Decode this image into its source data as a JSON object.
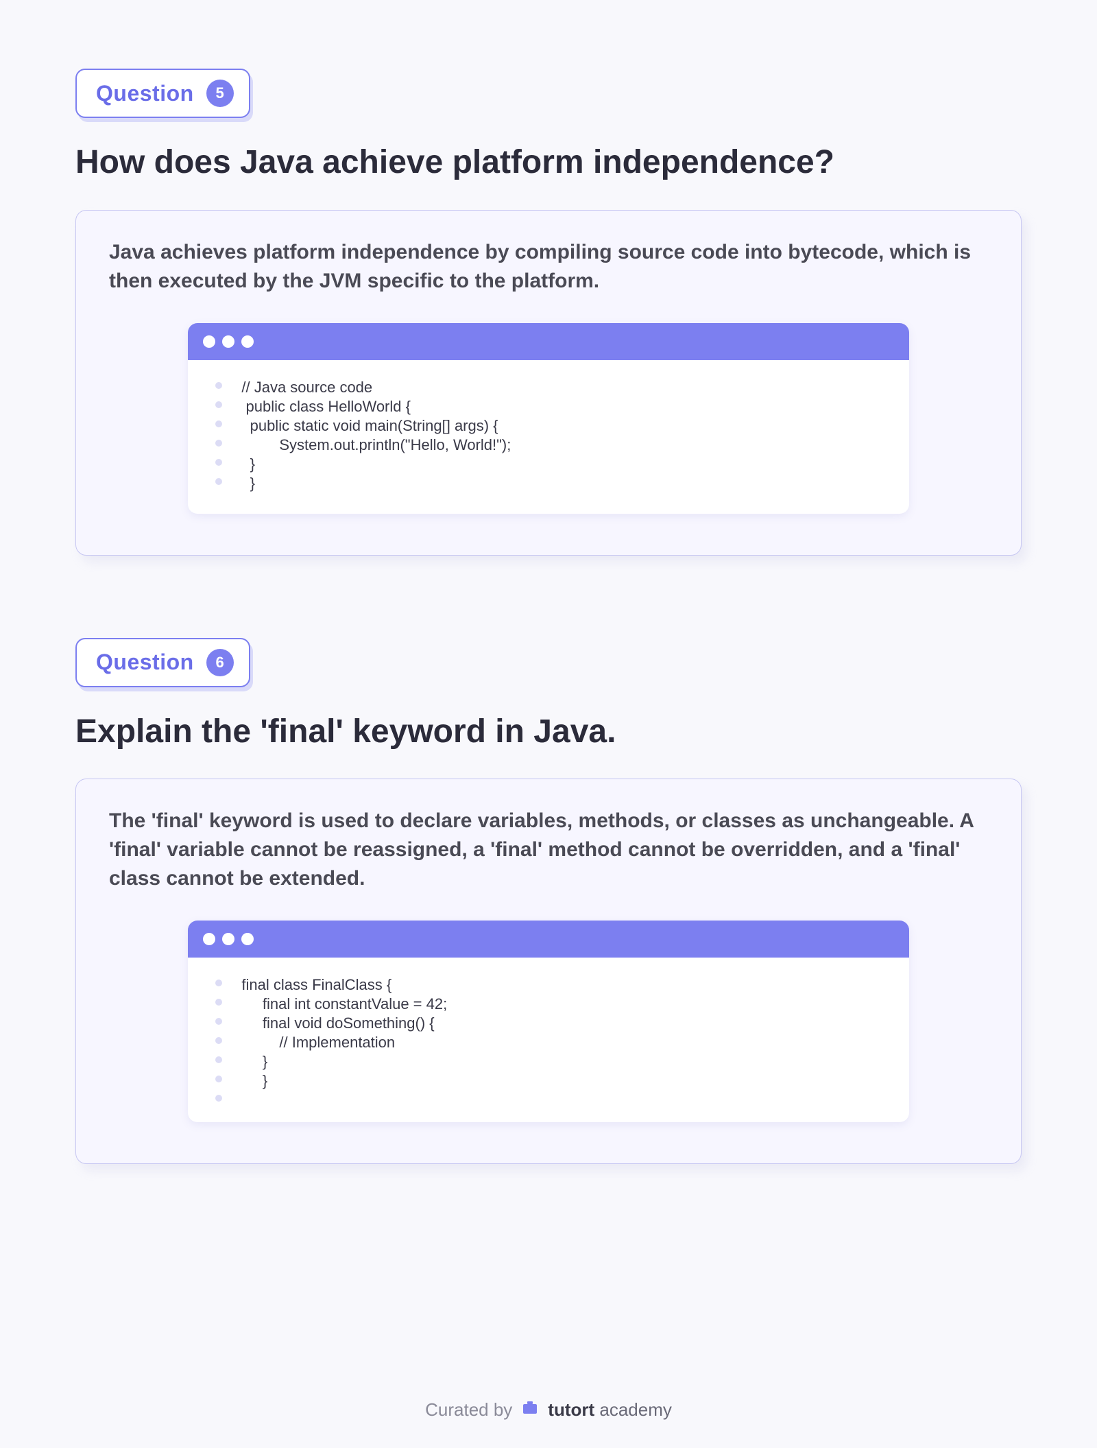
{
  "questions": [
    {
      "badge_label": "Question",
      "badge_number": "5",
      "title": "How does Java achieve platform independence?",
      "answer": "Java achieves platform independence by compiling source code into bytecode, which is then executed by the JVM specific to the platform.",
      "code": [
        "// Java source code",
        " public class HelloWorld {",
        "  public static void main(String[] args) {",
        "         System.out.println(\"Hello, World!\");",
        "  }",
        "  }"
      ]
    },
    {
      "badge_label": "Question",
      "badge_number": "6",
      "title": "Explain the 'final' keyword in Java.",
      "answer": "The 'final' keyword is used to declare variables, methods, or classes as unchangeable. A 'final' variable cannot be reassigned, a 'final' method cannot be overridden, and a 'final' class cannot be extended.",
      "code": [
        "final class FinalClass {",
        "     final int constantValue = 42;",
        "",
        "     final void doSomething() {",
        "         // Implementation",
        "     }",
        "     }"
      ]
    }
  ],
  "footer": {
    "curated": "Curated by",
    "brand_main": "tutort",
    "brand_sub": " academy"
  }
}
